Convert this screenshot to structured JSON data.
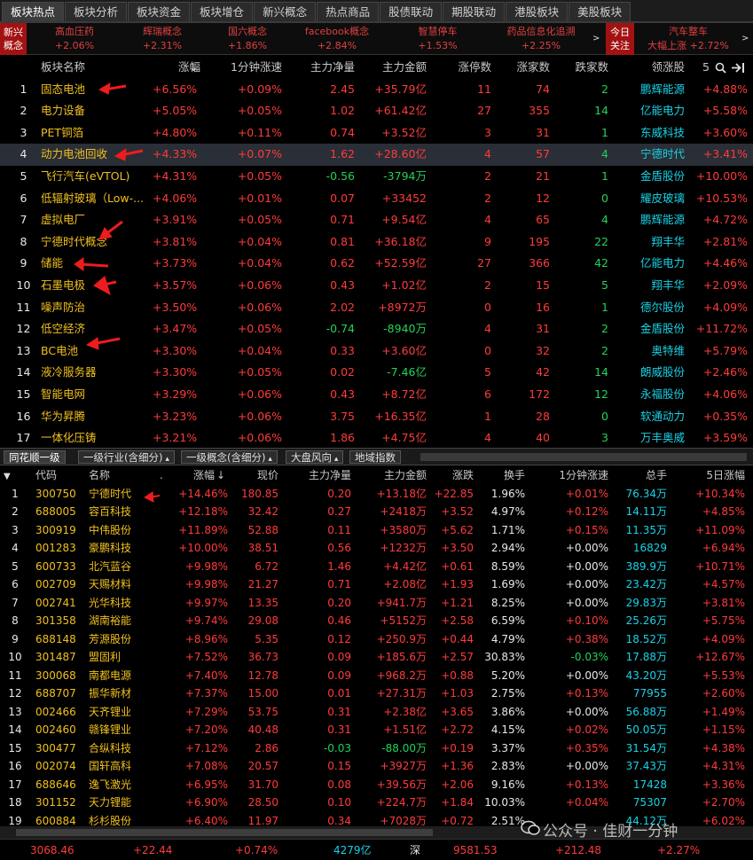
{
  "tabs": [
    "板块热点",
    "板块分析",
    "板块资金",
    "板块增仓",
    "新兴概念",
    "热点商品",
    "股债联动",
    "期股联动",
    "港股板块",
    "美股板块"
  ],
  "ticker": {
    "side_label_1": "新兴",
    "side_label_2": "概念",
    "items": [
      {
        "name": "高血压药",
        "value": "+2.06%"
      },
      {
        "name": "辉瑞概念",
        "value": "+2.31%"
      },
      {
        "name": "国六概念",
        "value": "+1.86%"
      },
      {
        "name": "facebook概念",
        "value": "+2.84%"
      },
      {
        "name": "智慧停车",
        "value": "+1.53%"
      },
      {
        "name": "药品信息化追溯",
        "value": "+2.25%"
      }
    ],
    "today_1": "今日",
    "today_2": "关注",
    "last_name": "汽车整车",
    "last_value": "大幅上涨 +2.72%"
  },
  "sector_table": {
    "headers": [
      "板块名称",
      "涨幅",
      "1分钟涨速",
      "主力净量",
      "主力金额",
      "涨停数",
      "涨家数",
      "跌家数",
      "领涨股",
      "5"
    ],
    "rows": [
      {
        "no": "1",
        "name": "固态电池",
        "chg": "+6.56%",
        "speed": "+0.09%",
        "net": "2.45",
        "amt": "+35.79亿",
        "limit": "11",
        "up": "74",
        "down": "2",
        "lead": "鹏辉能源",
        "lead_chg": "+4.88%"
      },
      {
        "no": "2",
        "name": "电力设备",
        "chg": "+5.05%",
        "speed": "+0.05%",
        "net": "1.02",
        "amt": "+61.42亿",
        "limit": "27",
        "up": "355",
        "down": "14",
        "lead": "亿能电力",
        "lead_chg": "+5.58%"
      },
      {
        "no": "3",
        "name": "PET铜箔",
        "chg": "+4.80%",
        "speed": "+0.11%",
        "net": "0.74",
        "amt": "+3.52亿",
        "limit": "3",
        "up": "31",
        "down": "1",
        "lead": "东威科技",
        "lead_chg": "+3.60%"
      },
      {
        "no": "4",
        "name": "动力电池回收",
        "chg": "+4.33%",
        "speed": "+0.07%",
        "net": "1.62",
        "amt": "+28.60亿",
        "limit": "4",
        "up": "57",
        "down": "4",
        "lead": "宁德时代",
        "lead_chg": "+3.41%"
      },
      {
        "no": "5",
        "name": "飞行汽车(eVTOL)",
        "chg": "+4.31%",
        "speed": "+0.05%",
        "net": "-0.56",
        "amt": "-3794万",
        "limit": "2",
        "up": "21",
        "down": "1",
        "lead": "金盾股份",
        "lead_chg": "+10.00%"
      },
      {
        "no": "6",
        "name": "低辐射玻璃（Low-...",
        "chg": "+4.06%",
        "speed": "+0.01%",
        "net": "0.07",
        "amt": "+33452",
        "limit": "2",
        "up": "12",
        "down": "0",
        "lead": "耀皮玻璃",
        "lead_chg": "+10.53%"
      },
      {
        "no": "7",
        "name": "虚拟电厂",
        "chg": "+3.91%",
        "speed": "+0.05%",
        "net": "0.71",
        "amt": "+9.54亿",
        "limit": "4",
        "up": "65",
        "down": "4",
        "lead": "鹏辉能源",
        "lead_chg": "+4.72%"
      },
      {
        "no": "8",
        "name": "宁德时代概念",
        "chg": "+3.81%",
        "speed": "+0.04%",
        "net": "0.81",
        "amt": "+36.18亿",
        "limit": "9",
        "up": "195",
        "down": "22",
        "lead": "翔丰华",
        "lead_chg": "+2.81%"
      },
      {
        "no": "9",
        "name": "储能",
        "chg": "+3.73%",
        "speed": "+0.04%",
        "net": "0.62",
        "amt": "+52.59亿",
        "limit": "27",
        "up": "366",
        "down": "42",
        "lead": "亿能电力",
        "lead_chg": "+4.46%"
      },
      {
        "no": "10",
        "name": "石墨电极",
        "chg": "+3.57%",
        "speed": "+0.06%",
        "net": "0.43",
        "amt": "+1.02亿",
        "limit": "2",
        "up": "15",
        "down": "5",
        "lead": "翔丰华",
        "lead_chg": "+2.09%"
      },
      {
        "no": "11",
        "name": "噪声防治",
        "chg": "+3.50%",
        "speed": "+0.06%",
        "net": "2.02",
        "amt": "+8972万",
        "limit": "0",
        "up": "16",
        "down": "1",
        "lead": "德尔股份",
        "lead_chg": "+4.09%"
      },
      {
        "no": "12",
        "name": "低空经济",
        "chg": "+3.47%",
        "speed": "+0.05%",
        "net": "-0.74",
        "amt": "-8940万",
        "limit": "4",
        "up": "31",
        "down": "2",
        "lead": "金盾股份",
        "lead_chg": "+11.72%"
      },
      {
        "no": "13",
        "name": "BC电池",
        "chg": "+3.30%",
        "speed": "+0.04%",
        "net": "0.33",
        "amt": "+3.60亿",
        "limit": "0",
        "up": "32",
        "down": "2",
        "lead": "奥特维",
        "lead_chg": "+5.79%"
      },
      {
        "no": "14",
        "name": "液冷服务器",
        "chg": "+3.30%",
        "speed": "+0.05%",
        "net": "0.02",
        "amt": "-7.46亿",
        "limit": "5",
        "up": "42",
        "down": "14",
        "lead": "朗威股份",
        "lead_chg": "+2.46%"
      },
      {
        "no": "15",
        "name": "智能电网",
        "chg": "+3.29%",
        "speed": "+0.06%",
        "net": "0.43",
        "amt": "+8.72亿",
        "limit": "6",
        "up": "172",
        "down": "12",
        "lead": "永福股份",
        "lead_chg": "+4.06%"
      },
      {
        "no": "16",
        "name": "华为昇腾",
        "chg": "+3.23%",
        "speed": "+0.06%",
        "net": "3.75",
        "amt": "+16.35亿",
        "limit": "1",
        "up": "28",
        "down": "0",
        "lead": "软通动力",
        "lead_chg": "+0.35%"
      },
      {
        "no": "17",
        "name": "一体化压铸",
        "chg": "+3.21%",
        "speed": "+0.06%",
        "net": "1.86",
        "amt": "+4.75亿",
        "limit": "4",
        "up": "40",
        "down": "3",
        "lead": "万丰奥威",
        "lead_chg": "+3.59%"
      }
    ]
  },
  "subtabs": [
    "同花顺一级",
    "一级行业(含细分)",
    "一级概念(含细分)",
    "大盘风向",
    "地域指数"
  ],
  "stock_table": {
    "headers": [
      "代码",
      "名称",
      ".",
      "涨幅",
      "现价",
      "主力净量",
      "主力金额",
      "涨跌",
      "换手",
      "1分钟涨速",
      "总手",
      "5日涨幅"
    ],
    "rows": [
      {
        "no": "1",
        "code": "300750",
        "name": "宁德时代",
        "chg": "+14.46%",
        "price": "180.85",
        "net": "0.20",
        "amt": "+13.18亿",
        "diff": "+22.85",
        "turn": "1.96%",
        "speed": "+0.01%",
        "vol": "76.34万",
        "d5": "+10.34%"
      },
      {
        "no": "2",
        "code": "688005",
        "name": "容百科技",
        "chg": "+12.18%",
        "price": "32.42",
        "net": "0.27",
        "amt": "+2418万",
        "diff": "+3.52",
        "turn": "4.97%",
        "speed": "+0.12%",
        "vol": "14.11万",
        "d5": "+4.85%"
      },
      {
        "no": "3",
        "code": "300919",
        "name": "中伟股份",
        "chg": "+11.89%",
        "price": "52.88",
        "net": "0.11",
        "amt": "+3580万",
        "diff": "+5.62",
        "turn": "1.71%",
        "speed": "+0.15%",
        "vol": "11.35万",
        "d5": "+11.09%"
      },
      {
        "no": "4",
        "code": "001283",
        "name": "豪鹏科技",
        "chg": "+10.00%",
        "price": "38.51",
        "net": "0.56",
        "amt": "+1232万",
        "diff": "+3.50",
        "turn": "2.94%",
        "speed": "+0.00%",
        "vol": "16829",
        "d5": "+6.94%"
      },
      {
        "no": "5",
        "code": "600733",
        "name": "北汽蓝谷",
        "chg": "+9.98%",
        "price": "6.72",
        "net": "1.46",
        "amt": "+4.42亿",
        "diff": "+0.61",
        "turn": "8.59%",
        "speed": "+0.00%",
        "vol": "389.9万",
        "d5": "+10.71%"
      },
      {
        "no": "6",
        "code": "002709",
        "name": "天赐材料",
        "chg": "+9.98%",
        "price": "21.27",
        "net": "0.71",
        "amt": "+2.08亿",
        "diff": "+1.93",
        "turn": "1.69%",
        "speed": "+0.00%",
        "vol": "23.42万",
        "d5": "+4.57%"
      },
      {
        "no": "7",
        "code": "002741",
        "name": "光华科技",
        "chg": "+9.97%",
        "price": "13.35",
        "net": "0.20",
        "amt": "+941.7万",
        "diff": "+1.21",
        "turn": "8.25%",
        "speed": "+0.00%",
        "vol": "29.83万",
        "d5": "+3.81%"
      },
      {
        "no": "8",
        "code": "301358",
        "name": "湖南裕能",
        "chg": "+9.74%",
        "price": "29.08",
        "net": "0.46",
        "amt": "+5152万",
        "diff": "+2.58",
        "turn": "6.59%",
        "speed": "+0.10%",
        "vol": "25.26万",
        "d5": "+5.75%"
      },
      {
        "no": "9",
        "code": "688148",
        "name": "芳源股份",
        "chg": "+8.96%",
        "price": "5.35",
        "net": "0.12",
        "amt": "+250.9万",
        "diff": "+0.44",
        "turn": "4.79%",
        "speed": "+0.38%",
        "vol": "18.52万",
        "d5": "+4.09%"
      },
      {
        "no": "10",
        "code": "301487",
        "name": "盟固利",
        "chg": "+7.52%",
        "price": "36.73",
        "net": "0.09",
        "amt": "+185.6万",
        "diff": "+2.57",
        "turn": "30.83%",
        "speed": "-0.03%",
        "vol": "17.88万",
        "d5": "+12.67%"
      },
      {
        "no": "11",
        "code": "300068",
        "name": "南都电源",
        "chg": "+7.40%",
        "price": "12.78",
        "net": "0.09",
        "amt": "+968.2万",
        "diff": "+0.88",
        "turn": "5.20%",
        "speed": "+0.00%",
        "vol": "43.20万",
        "d5": "+5.53%"
      },
      {
        "no": "12",
        "code": "688707",
        "name": "振华新材",
        "chg": "+7.37%",
        "price": "15.00",
        "net": "0.01",
        "amt": "+27.31万",
        "diff": "+1.03",
        "turn": "2.75%",
        "speed": "+0.13%",
        "vol": "77955",
        "d5": "+2.60%"
      },
      {
        "no": "13",
        "code": "002466",
        "name": "天齐锂业",
        "chg": "+7.29%",
        "price": "53.75",
        "net": "0.31",
        "amt": "+2.38亿",
        "diff": "+3.65",
        "turn": "3.86%",
        "speed": "+0.00%",
        "vol": "56.88万",
        "d5": "+1.49%"
      },
      {
        "no": "14",
        "code": "002460",
        "name": "赣锋锂业",
        "chg": "+7.20%",
        "price": "40.48",
        "net": "0.31",
        "amt": "+1.51亿",
        "diff": "+2.72",
        "turn": "4.15%",
        "speed": "+0.02%",
        "vol": "50.05万",
        "d5": "+1.15%"
      },
      {
        "no": "15",
        "code": "300477",
        "name": "合纵科技",
        "chg": "+7.12%",
        "price": "2.86",
        "net": "-0.03",
        "amt": "-88.00万",
        "diff": "+0.19",
        "turn": "3.37%",
        "speed": "+0.35%",
        "vol": "31.54万",
        "d5": "+4.38%"
      },
      {
        "no": "16",
        "code": "002074",
        "name": "国轩高科",
        "chg": "+7.08%",
        "price": "20.57",
        "net": "0.15",
        "amt": "+3927万",
        "diff": "+1.36",
        "turn": "2.83%",
        "speed": "+0.00%",
        "vol": "37.43万",
        "d5": "+4.31%"
      },
      {
        "no": "17",
        "code": "688646",
        "name": "逸飞激光",
        "chg": "+6.95%",
        "price": "31.70",
        "net": "0.08",
        "amt": "+39.56万",
        "diff": "+2.06",
        "turn": "9.16%",
        "speed": "+0.13%",
        "vol": "17428",
        "d5": "+3.36%"
      },
      {
        "no": "18",
        "code": "301152",
        "name": "天力锂能",
        "chg": "+6.90%",
        "price": "28.50",
        "net": "0.10",
        "amt": "+224.7万",
        "diff": "+1.84",
        "turn": "10.03%",
        "speed": "+0.04%",
        "vol": "75307",
        "d5": "+2.70%"
      },
      {
        "no": "19",
        "code": "600884",
        "name": "杉杉股份",
        "chg": "+6.40%",
        "price": "11.97",
        "net": "0.34",
        "amt": "+7028万",
        "diff": "+0.72",
        "turn": "2.51%",
        "speed": "",
        "vol": "44.12万",
        "d5": "+6.02%"
      }
    ]
  },
  "status": {
    "sh_index": "3068.46",
    "sh_diff": "+22.44",
    "sh_pct": "+0.74%",
    "sh_amt": "4279亿",
    "sz_label": "深",
    "sz_index": "9581.53",
    "sz_diff": "+212.48",
    "sz_pct": "+2.27%"
  },
  "watermark": "公众号 · 佳财一分钟",
  "colors": {
    "up": "#ff3b3b",
    "down": "#22d25a",
    "name": "#f0c020",
    "lead": "#19d2e6",
    "arrow": "#ee1c1c"
  }
}
